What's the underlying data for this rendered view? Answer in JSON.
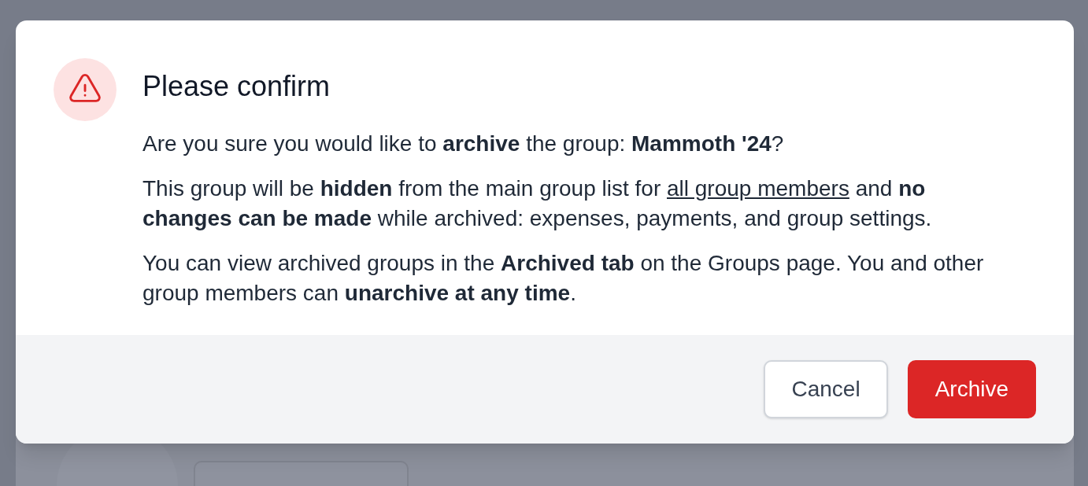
{
  "dialog": {
    "title": "Please confirm",
    "paragraphs": [
      [
        {
          "kind": "text",
          "text": "Are you sure you would like to **archive** the group: **Mammoth '24**?"
        }
      ],
      [
        {
          "kind": "text",
          "text": "This group will be **hidden** from the main group list for "
        },
        {
          "kind": "link",
          "text": "all group members"
        },
        {
          "kind": "text",
          "text": " and **no changes can be made** while archived: expenses, payments, and group settings."
        }
      ],
      [
        {
          "kind": "text",
          "text": "You can view archived groups in the **Archived tab** on the Groups page. You and other group members can **unarchive at any time**."
        }
      ]
    ],
    "buttons": [
      {
        "label": "Cancel",
        "kind": "secondary"
      },
      {
        "label": "Archive",
        "kind": "danger"
      }
    ]
  }
}
